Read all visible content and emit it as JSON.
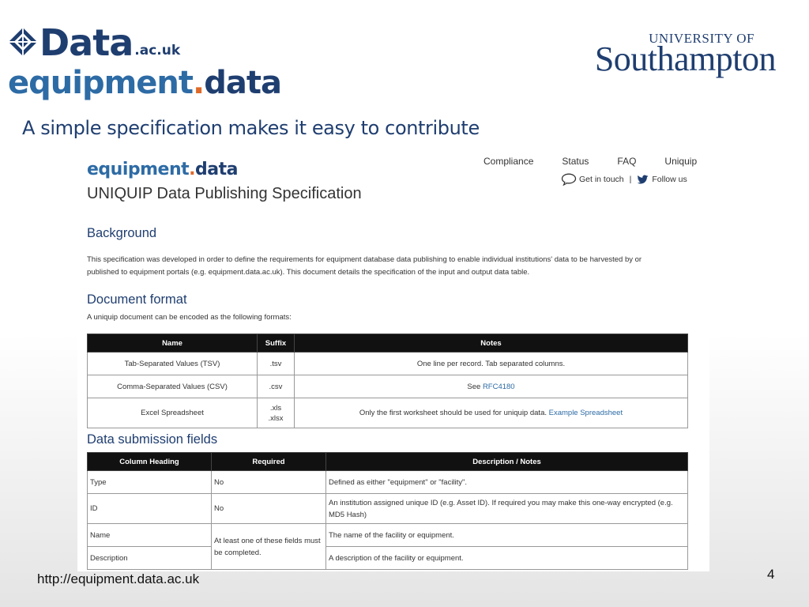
{
  "logos": {
    "data_word": "Data",
    "data_suffix": ".ac.uk",
    "equip_a": "equipment",
    "equip_dot": ".",
    "equip_b": "data",
    "university_line": "UNIVERSITY OF",
    "university_name": "Southampton"
  },
  "slide": {
    "title": "A simple specification makes it easy to contribute",
    "footer_url": "http://equipment.data.ac.uk",
    "page_number": "4"
  },
  "site": {
    "logo_a": "equipment",
    "logo_dot": ".",
    "logo_b": "data",
    "spec_title": "UNIQUIP Data Publishing Specification",
    "nav": [
      "Compliance",
      "Status",
      "FAQ",
      "Uniquip"
    ],
    "contact_label": "Get in touch",
    "separator": "|",
    "follow_label": "Follow us"
  },
  "background": {
    "heading": "Background",
    "text": "This specification was developed in order to define the requirements for equipment database data publishing to enable individual institutions' data to be harvested by or published to equipment portals (e.g. equipment.data.ac.uk). This document details the specification of the input and output data table."
  },
  "document_format": {
    "heading": "Document format",
    "intro": "A uniquip document can be encoded as the following formats:",
    "columns": [
      "Name",
      "Suffix",
      "Notes"
    ],
    "rows": [
      {
        "name": "Tab-Separated Values (TSV)",
        "suffix": ".tsv",
        "suffix2": "",
        "notes": "One line per record. Tab separated columns.",
        "link": ""
      },
      {
        "name": "Comma-Separated Values (CSV)",
        "suffix": ".csv",
        "suffix2": "",
        "notes": "See ",
        "link": "RFC4180"
      },
      {
        "name": "Excel Spreadsheet",
        "suffix": ".xls",
        "suffix2": ".xlsx",
        "notes": "Only the first worksheet should be used for uniquip data. ",
        "link": "Example Spreadsheet"
      }
    ]
  },
  "submission_fields": {
    "heading": "Data submission fields",
    "columns": [
      "Column Heading",
      "Required",
      "Description / Notes"
    ],
    "rows": [
      {
        "heading": "Type",
        "required": "No",
        "description": "Defined as either \"equipment\" or \"facility\"."
      },
      {
        "heading": "ID",
        "required": "No",
        "description": "An institution assigned unique ID (e.g. Asset ID). If required you may make this one-way encrypted (e.g. MD5 Hash)"
      },
      {
        "heading": "Name",
        "required": "At least one of these fields must be completed.",
        "description": "The name of the facility or equipment."
      },
      {
        "heading": "Description",
        "required": "",
        "description": "A description of the facility or equipment."
      }
    ]
  },
  "colors": {
    "navy": "#1f3e70",
    "blue": "#2d6ba5",
    "orange": "#e06a2a",
    "header_bg": "#111111"
  },
  "icons": [
    "data-diamond-logo-icon",
    "speech-bubble-icon",
    "twitter-bird-icon"
  ]
}
